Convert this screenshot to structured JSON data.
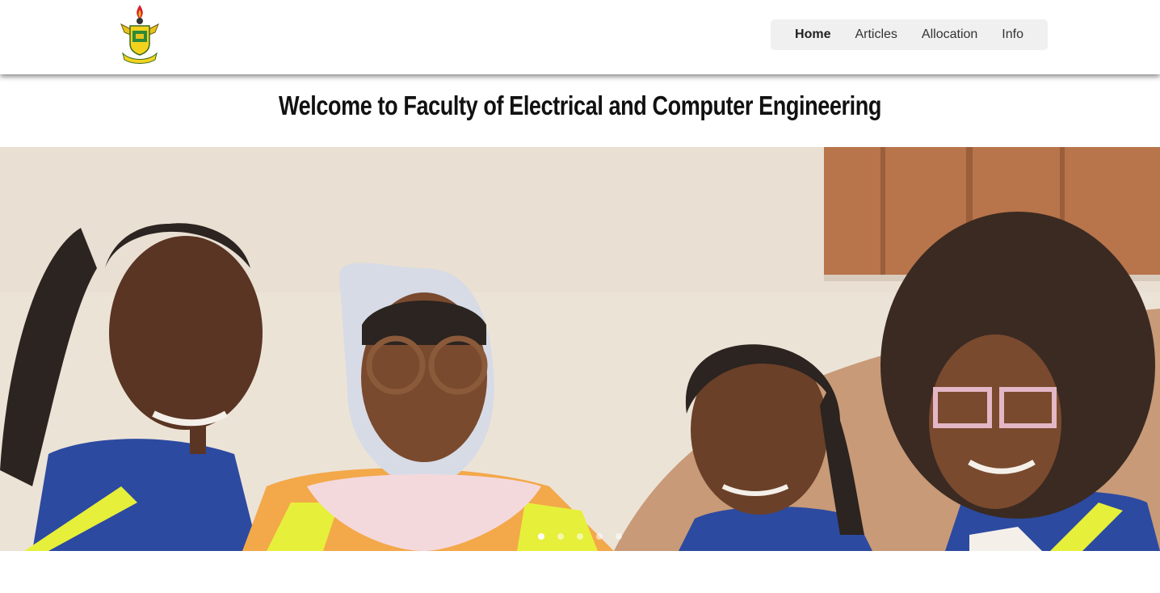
{
  "header": {
    "logo_name": "university-crest-logo",
    "nav": [
      {
        "label": "Home",
        "active": true
      },
      {
        "label": "Articles",
        "active": false
      },
      {
        "label": "Allocation",
        "active": false
      },
      {
        "label": "Info",
        "active": false
      }
    ]
  },
  "main": {
    "welcome_title": "Welcome to Faculty of Electrical and Computer Engineering"
  },
  "carousel": {
    "slide_count": 5,
    "active_index": 0
  },
  "colors": {
    "nav_bg": "#f0f0f0",
    "wall": "#ece3d7",
    "shutter": "#b8744a",
    "uniform_blue": "#2c4aa0",
    "reflective_yellow": "#e6ef3a"
  }
}
